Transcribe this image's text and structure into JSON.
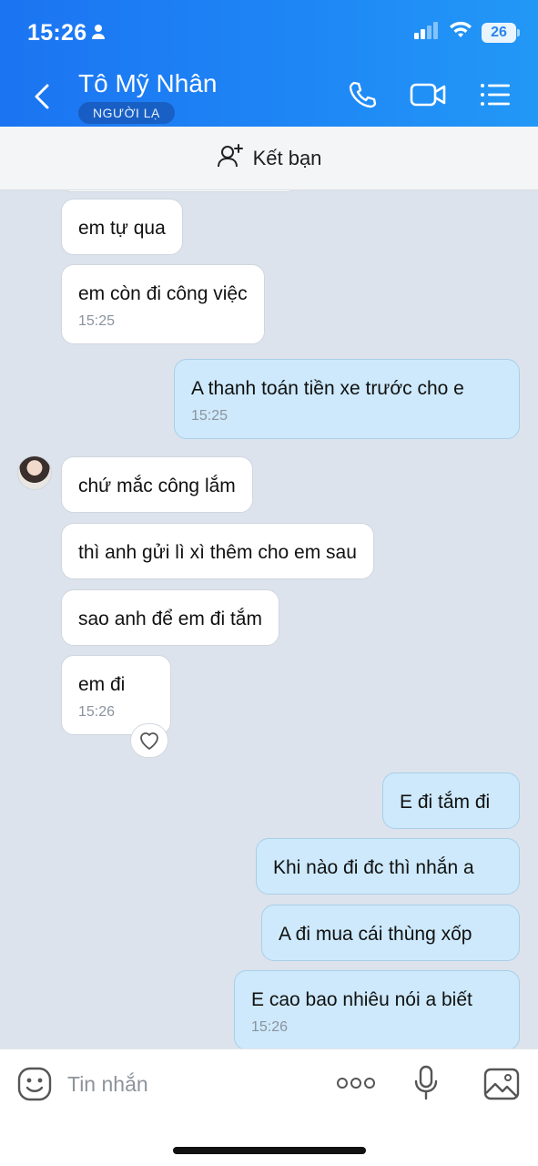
{
  "status_bar": {
    "time": "15:26",
    "battery": "26"
  },
  "header": {
    "contact_name": "Tô Mỹ Nhân",
    "badge": "NGƯỜI LẠ",
    "icons": [
      "back-chevron-icon",
      "phone-icon",
      "video-call-icon",
      "menu-list-icon"
    ]
  },
  "friend_bar": {
    "label": "Kết bạn",
    "icon": "add-friend-icon"
  },
  "messages": [
    {
      "dir": "in",
      "text": "em tự qua",
      "time": ""
    },
    {
      "dir": "in",
      "text": "em còn đi công việc",
      "time": "15:25"
    },
    {
      "dir": "out",
      "text": "A thanh toán tiền xe trước cho e",
      "time": "15:25"
    },
    {
      "dir": "in",
      "text": "chứ mắc công lắm",
      "time": ""
    },
    {
      "dir": "in",
      "text": "thì anh gửi lì xì thêm cho em sau",
      "time": ""
    },
    {
      "dir": "in",
      "text": "sao anh để em đi tắm",
      "time": ""
    },
    {
      "dir": "in",
      "text": "em đi",
      "time": "15:26"
    },
    {
      "dir": "out",
      "text": "E đi tắm đi",
      "time": ""
    },
    {
      "dir": "out",
      "text": "Khi nào đi đc thì nhắn a",
      "time": ""
    },
    {
      "dir": "out",
      "text": "A đi mua cái thùng xốp",
      "time": ""
    },
    {
      "dir": "out",
      "text": "E cao bao nhiêu nói a biết",
      "time": "15:26"
    }
  ],
  "input_bar": {
    "placeholder": "Tin nhắn",
    "icons": [
      "emoji-icon",
      "more-dots-icon",
      "microphone-icon",
      "image-icon"
    ]
  },
  "colors": {
    "header_start": "#1b74f2",
    "header_end": "#2298f6",
    "chat_background": "#dde3ec",
    "incoming_bubble": "#ffffff",
    "outgoing_bubble": "#cde9fb"
  }
}
